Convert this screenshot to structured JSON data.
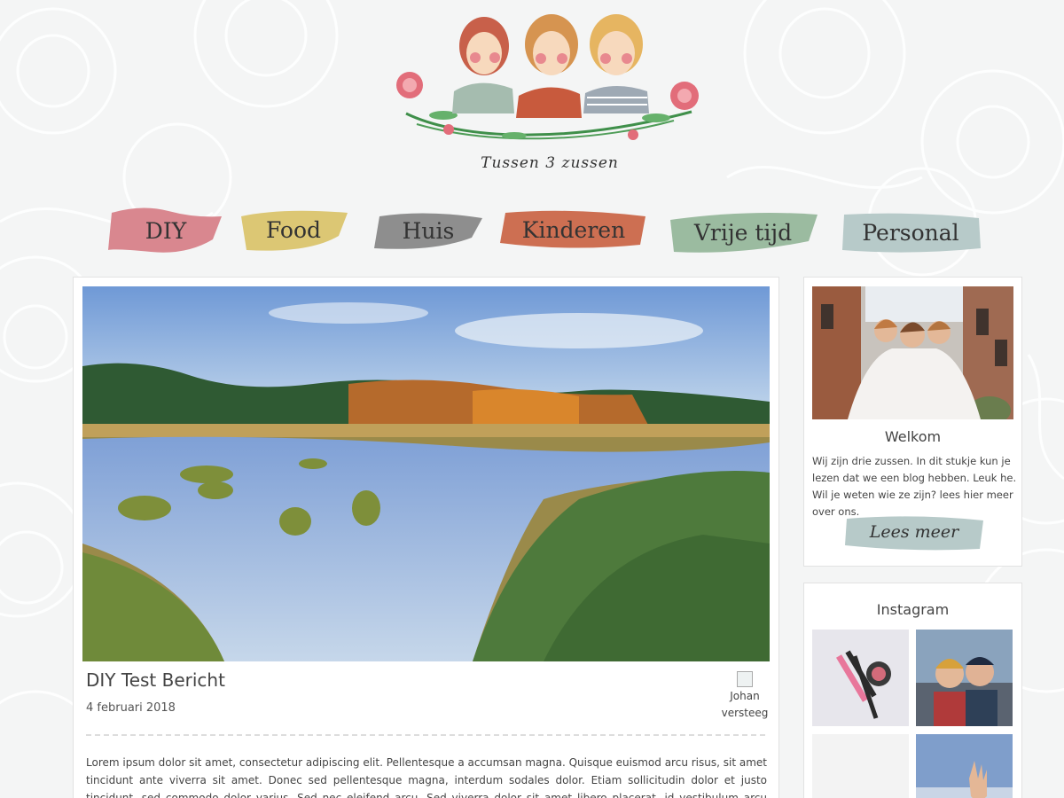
{
  "logo": {
    "caption": "Tussen 3 zussen"
  },
  "nav": {
    "items": [
      {
        "label": "DIY",
        "color": "#d9878f"
      },
      {
        "label": "Food",
        "color": "#dcc774"
      },
      {
        "label": "Huis",
        "color": "#8e8e8e"
      },
      {
        "label": "Kinderen",
        "color": "#cd6f52"
      },
      {
        "label": "Vrije tijd",
        "color": "#9bbba0"
      },
      {
        "label": "Personal",
        "color": "#b7cac9"
      }
    ]
  },
  "post": {
    "title": "DIY Test Bericht",
    "date": "4 februari 2018",
    "author_name": "Johan versteeg",
    "excerpt": "Lorem ipsum dolor sit amet, consectetur adipiscing elit. Pellentesque a accumsan magna. Quisque euismod arcu risus, sit amet tincidunt ante viverra sit amet. Donec sed pellentesque magna, interdum sodales dolor. Etiam sollicitudin dolor et justo tincidunt, sed commodo dolor varius. Sed nec eleifend arcu. Sed viverra dolor sit amet libero placerat, id vestibulum arcu auctor. Donec mollis, eros id posuere condimentum, metus"
  },
  "sidebar": {
    "welcome": {
      "title": "Welkom",
      "text": "Wij zijn drie zussen. In dit stukje kun je lezen dat we een blog hebben. Leuk he. Wil je weten wie ze zijn? lees hier meer over ons.",
      "button_label": "Lees meer",
      "button_color": "#b7cac9"
    },
    "instagram": {
      "title": "Instagram"
    }
  },
  "colors": {
    "background": "#f4f5f5",
    "card": "#ffffff",
    "border": "#e2e2e2"
  }
}
